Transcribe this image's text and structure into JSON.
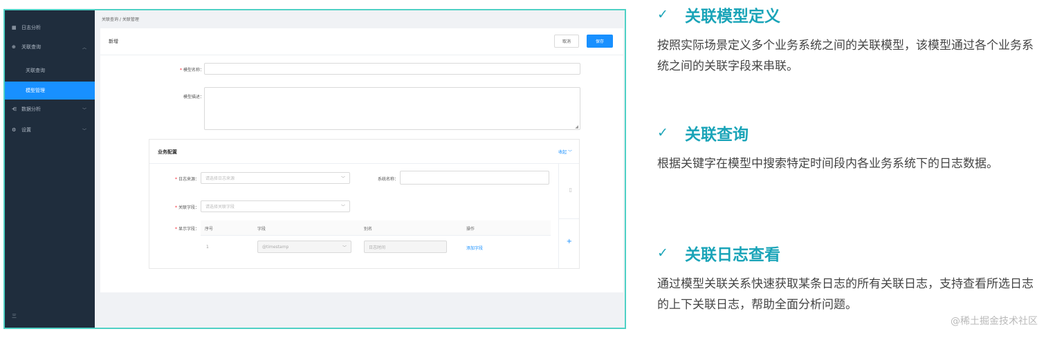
{
  "app": {
    "sidebar": {
      "items": [
        {
          "icon": "table-icon",
          "label": "日志分析"
        },
        {
          "icon": "link-icon",
          "label": "关联查询"
        },
        {
          "label": "关联查询"
        },
        {
          "label": "模型管理"
        },
        {
          "icon": "share-icon",
          "label": "数据分析"
        },
        {
          "icon": "gear-icon",
          "label": "设置"
        }
      ],
      "footer": "三"
    },
    "breadcrumb": "关联查询 / 关联管理",
    "card_title": "新增",
    "cancel_label": "取消",
    "save_label": "保存",
    "form": {
      "model_name_label": "模型名称：",
      "model_desc_label": "模型描述："
    },
    "config": {
      "title": "业务配置",
      "toggle": "收起",
      "source_label": "日志来源：",
      "source_placeholder": "请选择日志来源",
      "system_label": "系统名称：",
      "field_label": "关联字段：",
      "field_placeholder": "请选择关联字段",
      "display_label": "显示字段：",
      "columns": [
        "序号",
        "字段",
        "别名",
        "操作"
      ],
      "row": {
        "index": "1",
        "field": "@timestamp",
        "alias": "日志时间",
        "action": "添加字段"
      }
    }
  },
  "features": [
    {
      "title": "关联模型定义",
      "desc": "按照实际场景定义多个业务系统之间的关联模型，该模型通过各个业务系统之间的关联字段来串联。"
    },
    {
      "title": "关联查询",
      "desc": "根据关键字在模型中搜索特定时间段内各业务系统下的日志数据。"
    },
    {
      "title": "关联日志查看",
      "desc": "通过模型关联关系快速获取某条日志的所有关联日志，支持查看所选日志的上下关联日志，帮助全面分析问题。"
    }
  ],
  "watermark": "@稀土掘金技术社区",
  "colors": {
    "accent": "#1aa4b8",
    "sidebar": "#1f2d3d",
    "primary": "#1890ff"
  }
}
